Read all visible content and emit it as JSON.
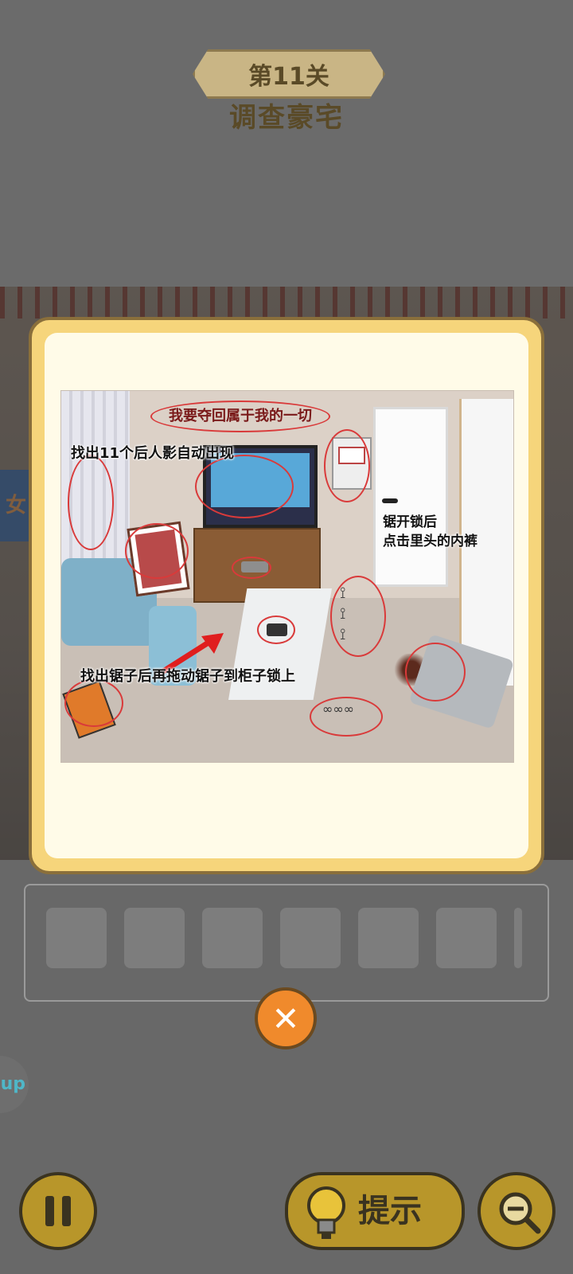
{
  "header": {
    "level_label": "第11关",
    "stage_title": "调查豪宅"
  },
  "background": {
    "sign_text": "女"
  },
  "hint_panel": {
    "graffiti_text": "我要夺回属于我的一切",
    "notes": {
      "shadow_note": "找出11个后人影自动出现",
      "saw_note": "找出锯子后再拖动锯子到柜子锁上",
      "cabinet_note_line1": "锯开锁后",
      "cabinet_note_line2": "点击里头的内裤"
    }
  },
  "inventory": {
    "slot_count": 6
  },
  "buttons": {
    "close_icon": "close-icon",
    "pause_icon": "pause-icon",
    "hint_label": "提示",
    "hint_icon": "lightbulb-icon",
    "zoom_icon": "zoom-out-icon",
    "side_badge": "up"
  },
  "colors": {
    "banner_fill": "#c9b585",
    "modal_border": "#f6d57b",
    "button_gold": "#b8962a",
    "close_orange": "#f08a2c",
    "circle_red": "#d93a3a"
  }
}
